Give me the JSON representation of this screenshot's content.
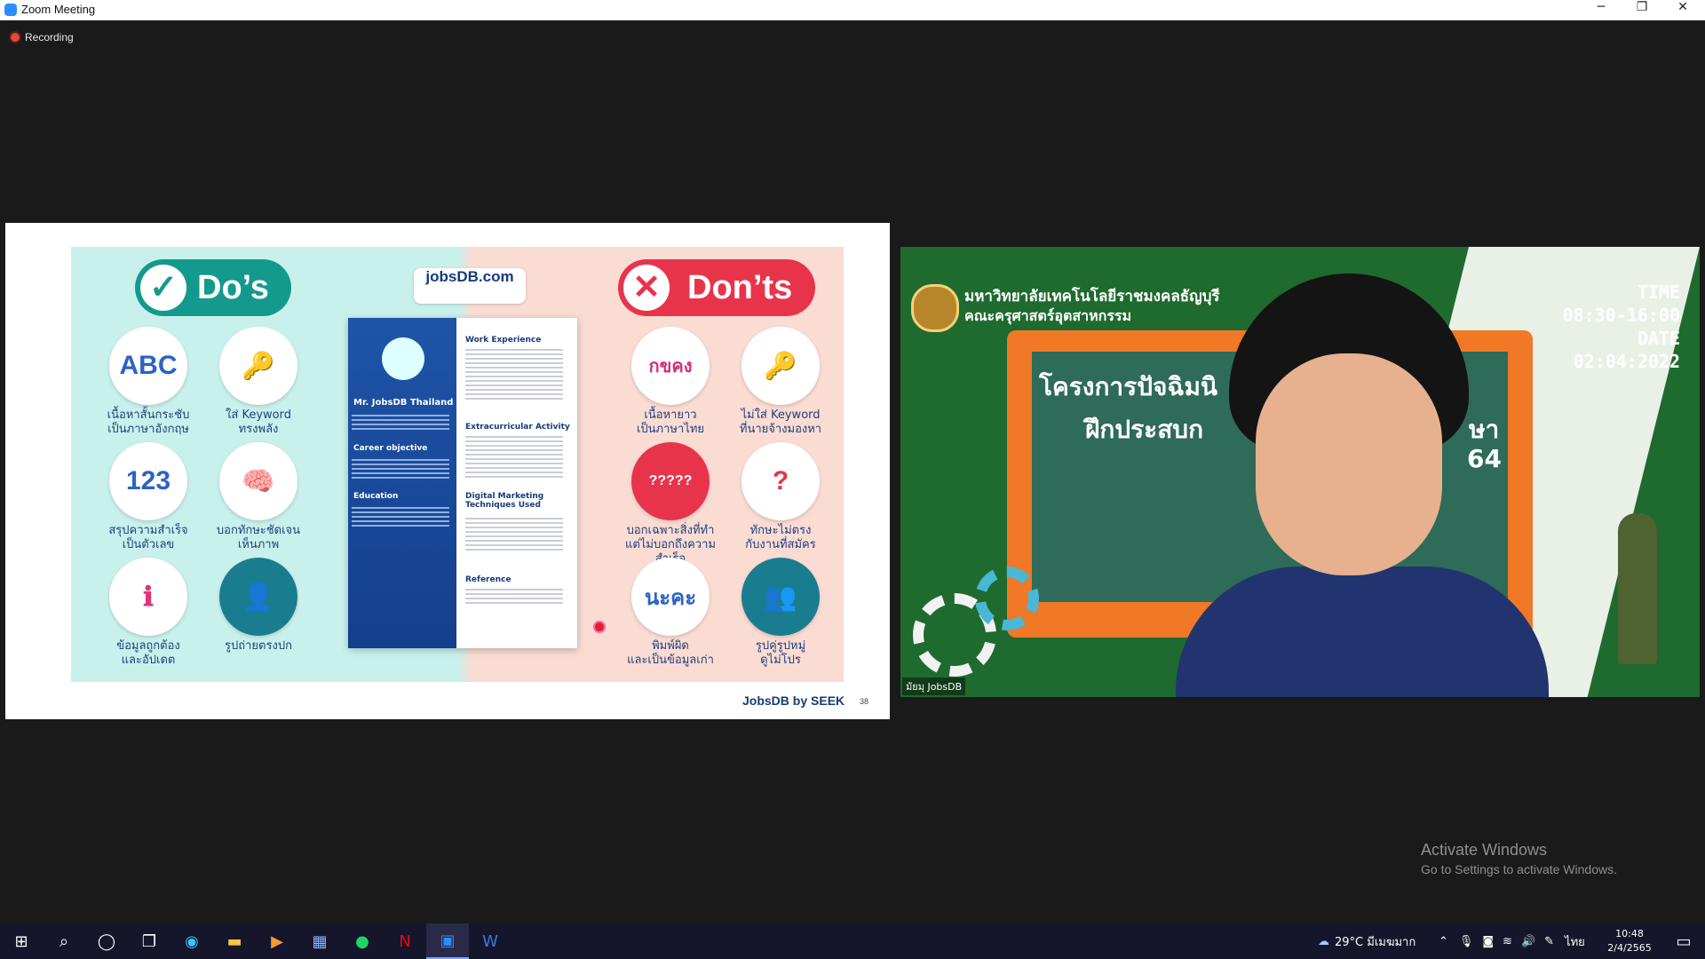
{
  "window": {
    "title": "Zoom Meeting",
    "minimize": "─",
    "restore": "❐",
    "close": "✕"
  },
  "recording": {
    "label": "Recording"
  },
  "slide": {
    "do_title": "Do’s",
    "dont_title": "Don’ts",
    "check_glyph": "✓",
    "x_glyph": "✕",
    "logo": "jobsDB.com",
    "do_items": [
      {
        "icon": "ABC",
        "label1": "เนื้อหาสั้นกระชับ",
        "label2": "เป็นภาษาอังกฤษ"
      },
      {
        "icon": "🔑",
        "label1": "ใส่ Keyword",
        "label2": "ทรงพลัง"
      },
      {
        "icon": "123",
        "label1": "สรุปความสำเร็จ",
        "label2": "เป็นตัวเลข"
      },
      {
        "icon": "🧠",
        "label1": "บอกทักษะชัดเจน",
        "label2": "เห็นภาพ"
      },
      {
        "icon": "ℹ",
        "label1": "ข้อมูลถูกต้อง",
        "label2": "และอัปเดต"
      },
      {
        "icon": "👤",
        "label1": "รูปถ่ายตรงปก",
        "label2": ""
      }
    ],
    "dont_items": [
      {
        "icon": "กขคง",
        "label1": "เนื้อหายาว",
        "label2": "เป็นภาษาไทย"
      },
      {
        "icon": "🔑",
        "label1": "ไม่ใส่ Keyword",
        "label2": "ที่นายจ้างมองหา"
      },
      {
        "icon": "?????",
        "label1": "บอกเฉพาะสิ่งที่ทำ",
        "label2": "แต่ไม่บอกถึงความสำเร็จ"
      },
      {
        "icon": "?",
        "label1": "ทักษะไม่ตรง",
        "label2": "กับงานที่สมัคร"
      },
      {
        "icon": "นะคะ",
        "label1": "พิมพ์ผิด",
        "label2": "และเป็นข้อมูลเก่า"
      },
      {
        "icon": "👥",
        "label1": "รูปคู่รูปหมู่",
        "label2": "ดูไม่โปร"
      }
    ],
    "resume": {
      "name": "Mr. JobsDB Thailand",
      "career": "Career objective",
      "education": "Education",
      "work": "Work Experience",
      "extra": "Extracurricular Activity",
      "digital": "Digital Marketing Techniques Used",
      "reference": "Reference"
    },
    "brand": "JobsDB by SEEK",
    "page_number": "38"
  },
  "video": {
    "uni_line1": "มหาวิทยาลัยเทคโนโลยีราชมงคลธัญบุรี",
    "uni_line2": "คณะครุศาสตร์อุตสาหกรรม",
    "board_line1": "โครงการปัจฉิมนิ",
    "board_line2": "ฝึกประสบก",
    "board_frag1": "ษา",
    "board_frag2": "64",
    "time_label": "TIME",
    "time_value": "08:30-16:00",
    "date_label": "DATE",
    "date_value": "02:04:2022",
    "participant": "มัยมุ JobsDB"
  },
  "activate": {
    "line1": "Activate Windows",
    "line2": "Go to Settings to activate Windows."
  },
  "taskbar": {
    "weather": "29°C มีเมฆมาก",
    "language": "ไทย",
    "time": "10:48",
    "date": "2/4/2565"
  }
}
